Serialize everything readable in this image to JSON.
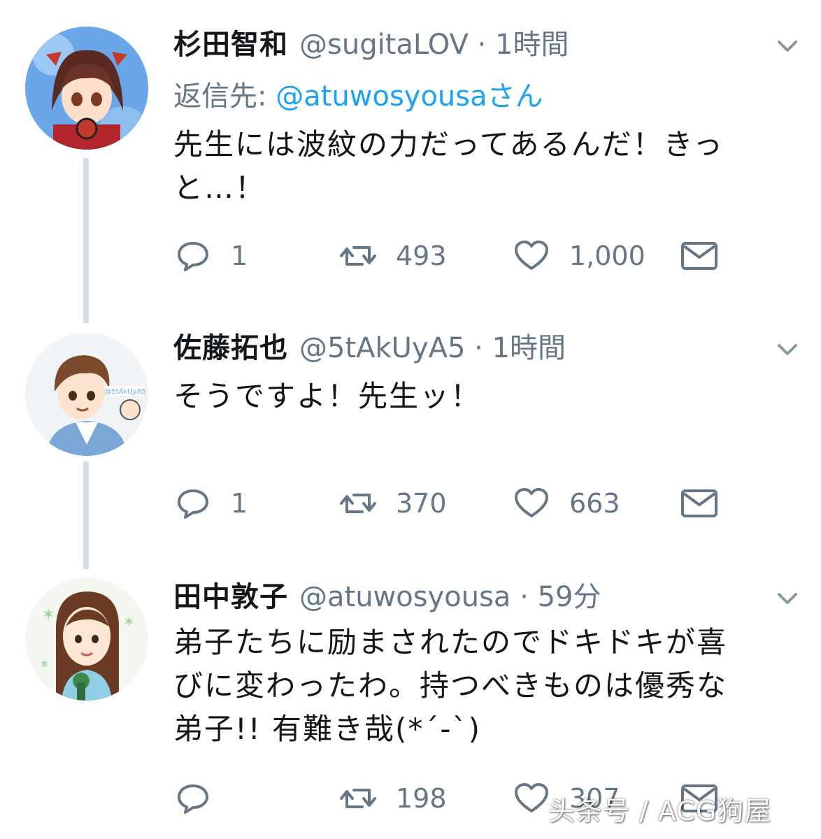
{
  "tweets": [
    {
      "name": "杉田智和",
      "handle": "@sugitaLOV",
      "dot": " · ",
      "time": "1時間",
      "reply_prefix": "返信先: ",
      "reply_mention": "@atuwosyousaさん",
      "text_line1": "先生には波紋の力だってあるんだ！きっ",
      "text_line2": "と…！",
      "replies": "1",
      "retweets": "493",
      "likes": "1,000"
    },
    {
      "name": "佐藤拓也",
      "handle": "@5tAkUyA5",
      "dot": " · ",
      "time": "1時間",
      "text_line1": "そうですよ！先生ッ！",
      "avatar_label": "@5tAkUyA5",
      "replies": "1",
      "retweets": "370",
      "likes": "663"
    },
    {
      "name": "田中敦子",
      "handle": "@atuwosyousa",
      "dot": " · ",
      "time": "59分",
      "text_line1": "弟子たちに励まされたのでドキドキが喜",
      "text_line2": "びに変わったわ。持つべきものは優秀な",
      "text_line3": "弟子!! 有難き哉(*´-`)",
      "retweets": "198",
      "likes": "307"
    }
  ],
  "watermark": "头条号 / ACG狗屋",
  "colors": {
    "text": "#14171a",
    "secondary": "#657786",
    "link": "#1da1f2",
    "thread_line": "#d3dde5"
  },
  "icons": {
    "reply": "reply-icon",
    "retweet": "retweet-icon",
    "like": "heart-icon",
    "dm": "envelope-icon",
    "menu": "chevron-down-icon"
  }
}
